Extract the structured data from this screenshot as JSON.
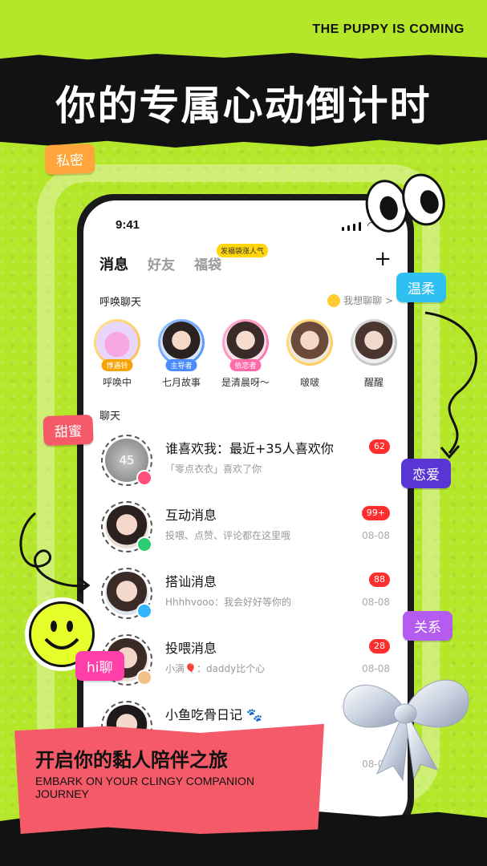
{
  "poster": {
    "tagline": "THE PUPPY IS COMING",
    "headline": "你的专属心动倒计时",
    "banner_title": "开启你的黏人陪伴之旅",
    "banner_subtitle": "EMBARK ON YOUR CLINGY COMPANION JOURNEY"
  },
  "stickers": {
    "simi": "私密",
    "wenrou": "温柔",
    "tianmi": "甜蜜",
    "lianai": "恋爱",
    "guanxi": "关系",
    "hiliao": "hi聊"
  },
  "phone": {
    "status_time": "9:41",
    "tabs": [
      {
        "label": "消息",
        "active": true
      },
      {
        "label": "好友",
        "active": false
      },
      {
        "label": "福袋",
        "active": false
      }
    ],
    "fudai_badge": "发福袋涨人气",
    "plus": "+",
    "summon_header": "呼唤聊天",
    "want_chat": "我想聊聊 >",
    "stories": [
      {
        "name": "呼唤中",
        "tag": "悸遇铃",
        "tag_color": "#f5a300"
      },
      {
        "name": "七月故事",
        "tag": "主导者",
        "tag_color": "#4a8cff"
      },
      {
        "name": "是清晨呀～",
        "tag": "依恋者",
        "tag_color": "#ff6aa8"
      },
      {
        "name": "啵啵",
        "tag": "",
        "tag_color": ""
      },
      {
        "name": "醒醒",
        "tag": "",
        "tag_color": ""
      }
    ],
    "chat_header": "聊天",
    "chats": [
      {
        "title": "谁喜欢我：最近+35人喜欢你",
        "sub": "「零点衣衣」喜欢了你",
        "badge": "62",
        "date": "",
        "avatar_text": "45"
      },
      {
        "title": "互动消息",
        "sub": "投喂、点赞、评论都在这里哦",
        "badge": "99+",
        "date": "08-08"
      },
      {
        "title": "搭讪消息",
        "sub": "Hhhhvooo：我会好好等你的",
        "badge": "88",
        "date": "08-08"
      },
      {
        "title": "投喂消息",
        "sub": "小满🎈：daddy比个心",
        "badge": "28",
        "date": "08-08"
      },
      {
        "title": "小鱼吃骨日记 🐾",
        "sub": "",
        "badge": "",
        "date": "08-08"
      }
    ]
  },
  "colors": {
    "background": "#b4e62a",
    "badge_red": "#ff2e2e",
    "banner_pink": "#f45a68"
  }
}
